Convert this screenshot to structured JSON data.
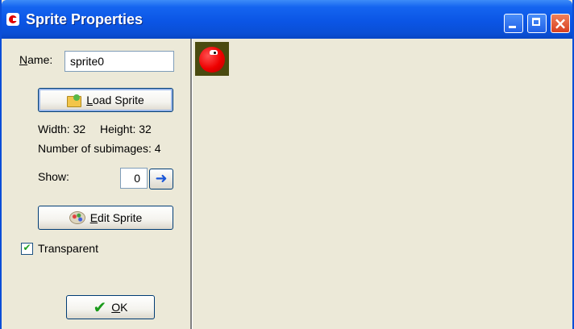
{
  "window": {
    "title": "Sprite Properties",
    "controls": {
      "close_glyph": "×"
    }
  },
  "form": {
    "name_label_prefix": "N",
    "name_label_rest": "ame:",
    "name_value": "sprite0",
    "load_button_prefix": "L",
    "load_button_rest": "oad Sprite",
    "width_text": "Width: 32",
    "height_text": "Height: 32",
    "subimages_text": "Number of subimages: 4",
    "show_label": "Show:",
    "show_value": "0",
    "next_arrow_glyph": "➜",
    "edit_button_prefix": "E",
    "edit_button_rest": "dit Sprite",
    "transparent_label": "Transparent",
    "transparent_checked": true,
    "checkmark_glyph": "✔",
    "ok_button_prefix": "O",
    "ok_button_rest": "K"
  },
  "icons": {
    "app": "game-maker-icon",
    "load": "open-folder-icon",
    "edit": "paint-palette-icon",
    "ok": "green-check-icon",
    "next": "right-arrow-icon"
  },
  "colors": {
    "titlebar": "#0b55e5",
    "window_bg": "#ece9d8",
    "sprite_red": "#ee0000",
    "sprite_bg": "#4a4a10"
  }
}
